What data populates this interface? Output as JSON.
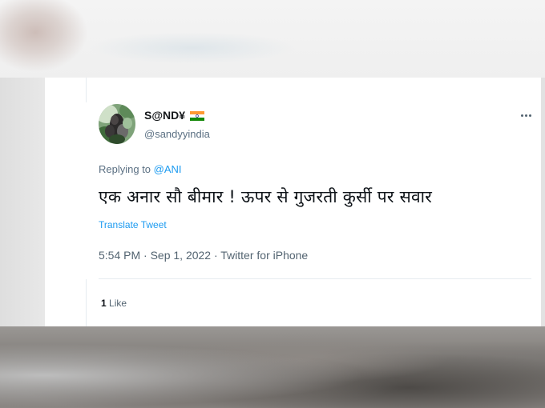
{
  "tweet": {
    "display_name": "S@ND¥",
    "handle": "@sandyyindia",
    "replying_to_label": "Replying to ",
    "replying_to_handle": "@ANI",
    "text": "एक अनार सौ बीमार ! ऊपर से गुजरती कुर्सी पर सवार",
    "translate_label": "Translate Tweet",
    "meta": "5:54 PM · Sep 1, 2022 · Twitter for iPhone",
    "likes_count": "1",
    "likes_label": " Like"
  },
  "icons": {
    "more": "more-horizontal-icon",
    "flag": "india-flag-icon"
  },
  "colors": {
    "link": "#1d9bf0",
    "secondary_text": "#536471",
    "primary_text": "#0f1419"
  }
}
